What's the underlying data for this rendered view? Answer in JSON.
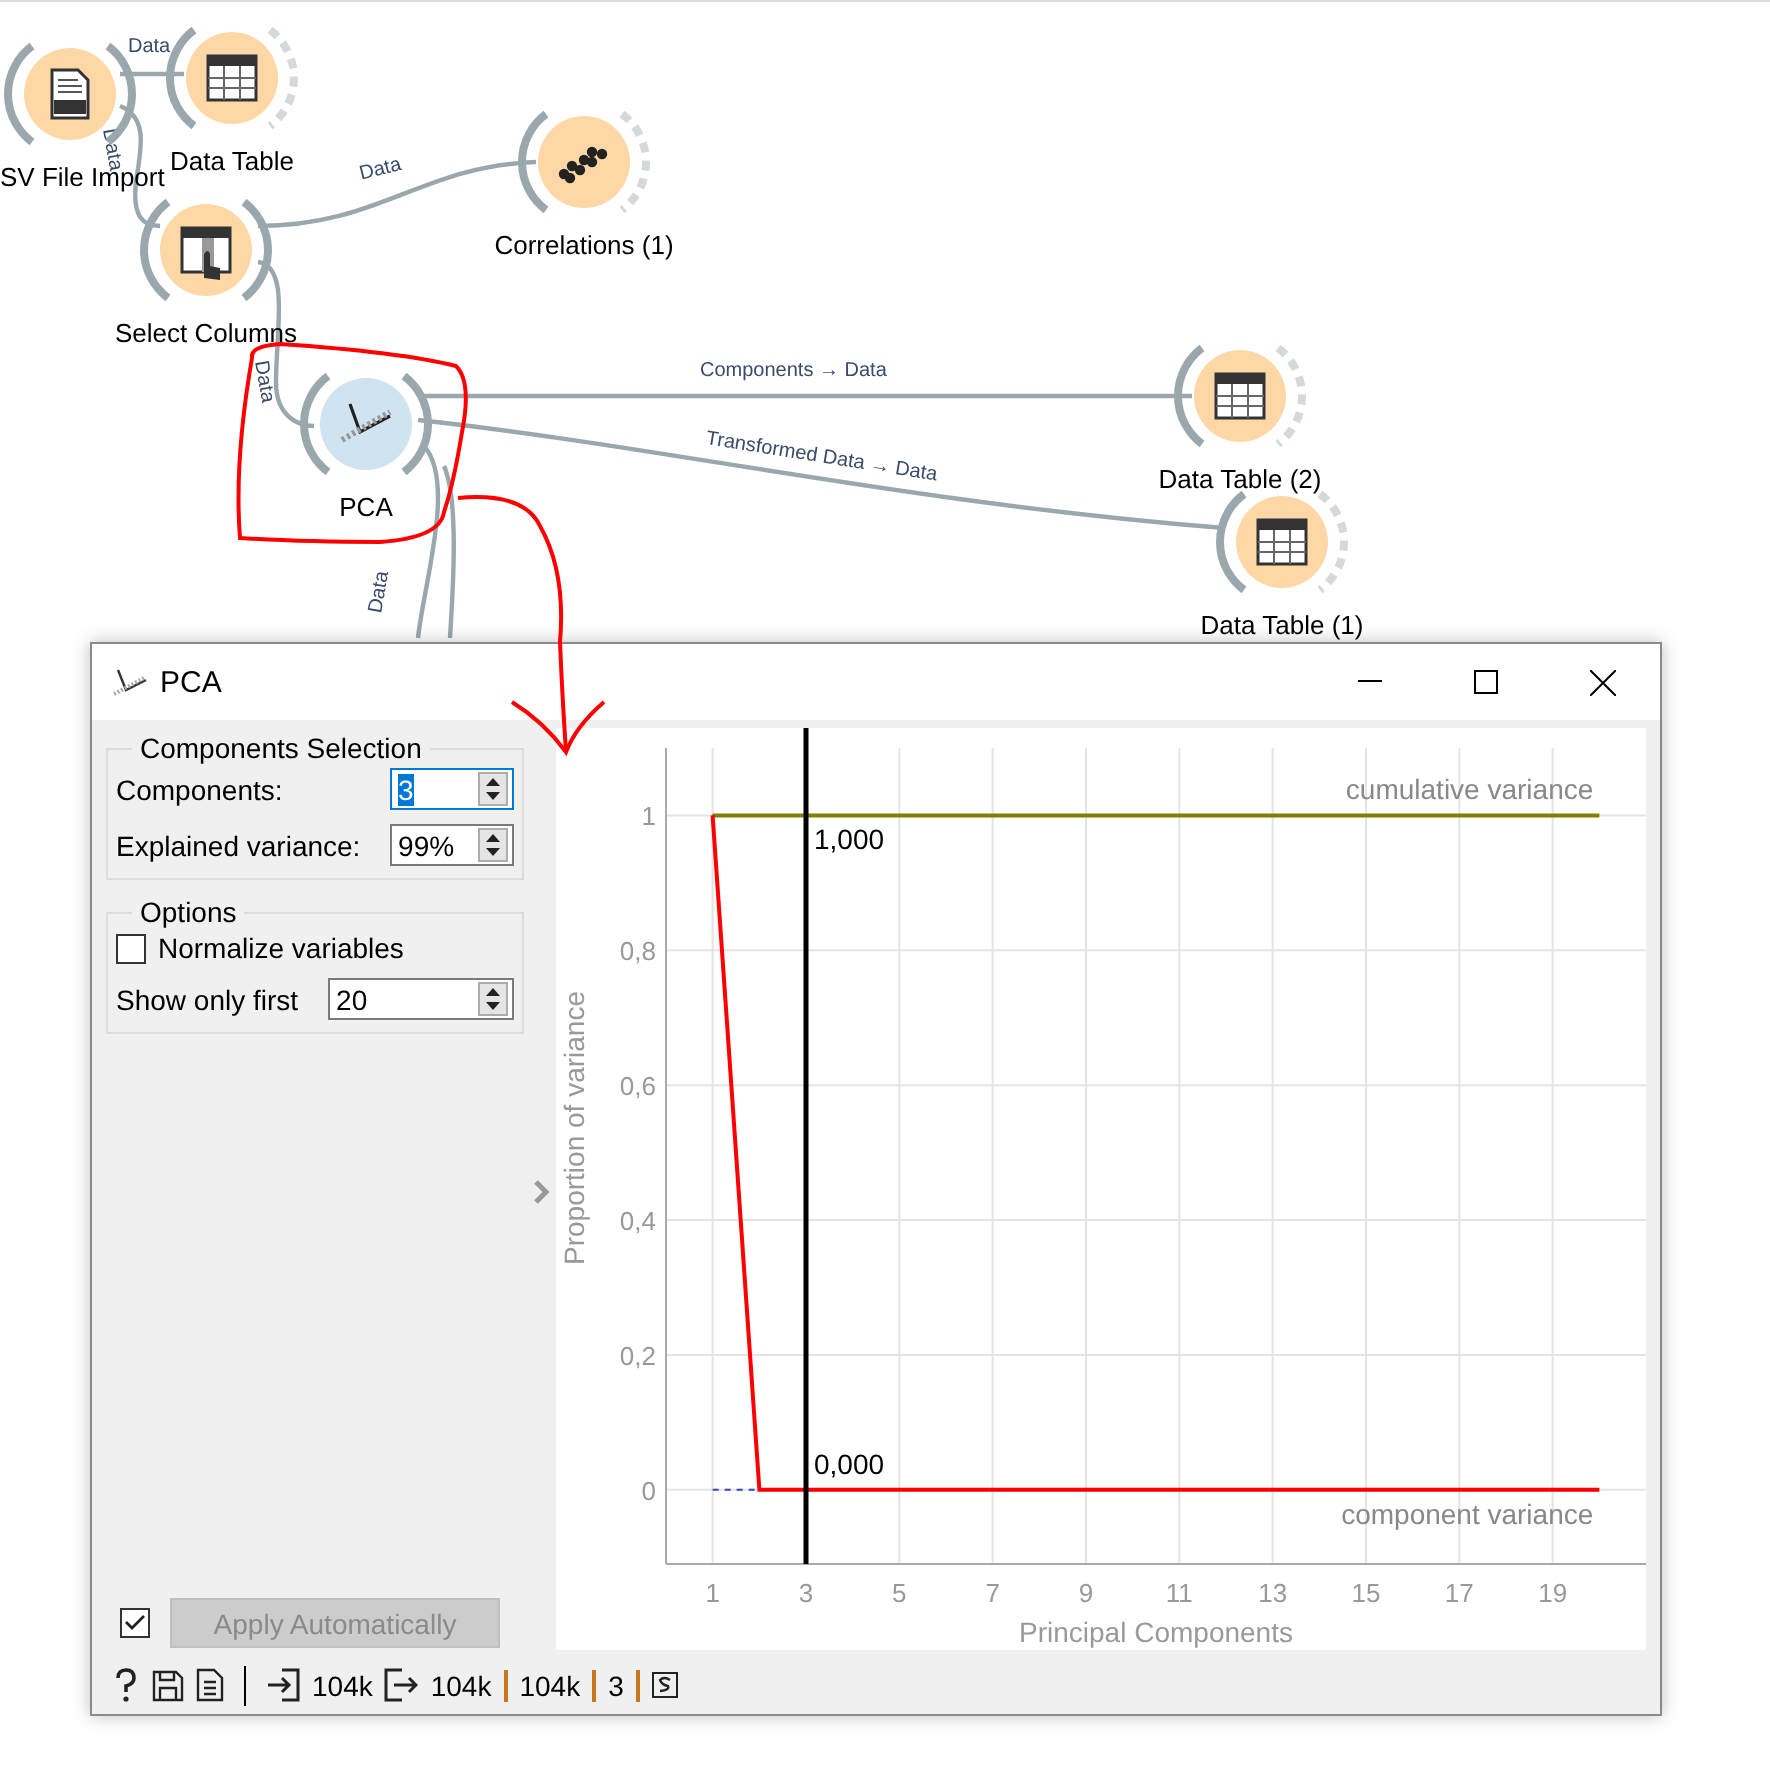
{
  "canvas": {
    "nodes": [
      {
        "label": "SV File Import",
        "kind": "csv",
        "color": "#fdd8a6",
        "outputs_connected": true
      },
      {
        "label": "Data Table",
        "kind": "table",
        "color": "#fdd8a6",
        "outputs_connected": false
      },
      {
        "label": "Select Columns",
        "kind": "select",
        "color": "#fdd8a6",
        "outputs_connected": true
      },
      {
        "label": "Correlations (1)",
        "kind": "dots",
        "color": "#fdd8a6",
        "outputs_connected": false
      },
      {
        "label": "PCA",
        "kind": "pca",
        "color": "#cfe3f0",
        "outputs_connected": true
      },
      {
        "label": "Data Table (2)",
        "kind": "table",
        "color": "#fdd8a6",
        "outputs_connected": false
      },
      {
        "label": "Data Table (1)",
        "kind": "table",
        "color": "#fdd8a6",
        "outputs_connected": false
      }
    ],
    "links": [
      {
        "label": "Data"
      },
      {
        "label": "Data"
      },
      {
        "label": "Data"
      },
      {
        "label": "Data"
      },
      {
        "label": "Components → Data"
      },
      {
        "label": "Transformed Data → Data"
      },
      {
        "label": "Data"
      }
    ]
  },
  "window": {
    "title": "PCA",
    "components_selection": {
      "title": "Components Selection",
      "components": {
        "label": "Components:",
        "value": "3",
        "focused": true
      },
      "explained_variance": {
        "label": "Explained variance:",
        "value": "99%"
      }
    },
    "options": {
      "title": "Options",
      "normalize": {
        "label": "Normalize variables",
        "checked": false
      },
      "show_only_first": {
        "label": "Show only first",
        "value": "20"
      }
    },
    "apply": {
      "checked": true,
      "label": "Apply Automatically",
      "disabled": true
    },
    "chart_data": {
      "type": "line",
      "xlabel": "Principal Components",
      "ylabel": "Proportion of variance",
      "xlim": [
        0,
        21
      ],
      "ylim": [
        -0.11,
        1.1
      ],
      "grid": true,
      "ref_lines": [
        {
          "axis": "x",
          "value": 3,
          "color": "#000000"
        }
      ],
      "xticks": [
        1,
        3,
        5,
        7,
        9,
        11,
        13,
        15,
        17,
        19
      ],
      "yticks": [
        {
          "value": 0,
          "label": "0"
        },
        {
          "value": 0.2,
          "label": "0,2"
        },
        {
          "value": 0.4,
          "label": "0,4"
        },
        {
          "value": 0.6,
          "label": "0,6"
        },
        {
          "value": 0.8,
          "label": "0,8"
        },
        {
          "value": 1,
          "label": "1"
        }
      ],
      "x": [
        1,
        2,
        3,
        4,
        5,
        6,
        7,
        8,
        9,
        10,
        11,
        12,
        13,
        14,
        15,
        16,
        17,
        18,
        19,
        20
      ],
      "series": [
        {
          "name": "cumulative variance",
          "color": "#808000",
          "values": [
            1,
            1,
            1,
            1,
            1,
            1,
            1,
            1,
            1,
            1,
            1,
            1,
            1,
            1,
            1,
            1,
            1,
            1,
            1,
            1
          ]
        },
        {
          "name": "component variance",
          "color": "#ff0000",
          "values": [
            1,
            0,
            0,
            0,
            0,
            0,
            0,
            0,
            0,
            0,
            0,
            0,
            0,
            0,
            0,
            0,
            0,
            0,
            0,
            0
          ]
        }
      ],
      "annotations": [
        {
          "text": "1,000",
          "x": 3,
          "y": 1
        },
        {
          "text": "0,000",
          "x": 3,
          "y": 0
        }
      ]
    },
    "status_bar": {
      "input": "104k",
      "output": [
        "104k",
        "104k",
        "3"
      ]
    }
  }
}
